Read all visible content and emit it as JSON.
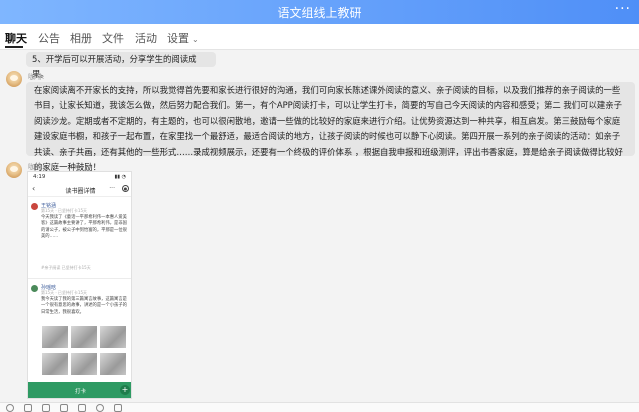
{
  "window": {
    "title": "语文组线上教研",
    "more_label": "···"
  },
  "tabs": [
    {
      "label": "聊天"
    },
    {
      "label": "公告"
    },
    {
      "label": "相册"
    },
    {
      "label": "文件"
    },
    {
      "label": "活动"
    },
    {
      "label": "设置"
    }
  ],
  "messages": [
    {
      "text": "5、开学后可以开展活动，分享学生的阅读成果。"
    },
    {
      "sender": "咖啡.",
      "text": "在家阅读离不开家长的支持，所以我觉得首先要和家长进行很好的沟通，我们可向家长陈述课外阅读的意义、亲子阅读的目标，以及我们推荐的亲子阅读的一些书目，让家长知道，我该怎么做，然后努力配合我们。第一，有个APP阅读打卡，可以让学生打卡，简要的写自己今天阅读的内容和感受；第二 我们可以建亲子阅读沙龙。定期或者不定期的，有主题的，也可以很闲散地，邀请一些做的比较好的家庭来进行介绍。让优势资源达到一种共享，相互启发。第三鼓励每个家庭建设家庭书橱，和孩子一起布置，在家里找一个最舒适，最适合阅读的地方，让孩子阅读的时候也可以静下心阅读。第四开展一系列的亲子阅读的活动：如亲子共读、亲子共画，还有其他的一些形式……录成视频展示，还要有一个终极的评价体系 ，根据自我申报和班级测评，评出书香家庭，算是给亲子阅读做得比较好的家庭一种鼓励！"
    },
    {
      "sender": "咖啡."
    }
  ],
  "screenshot": {
    "time": "4:19",
    "status_icons": "▮▮ ◔",
    "header_title": "读书圈详情",
    "back_icon": "‹",
    "menu_icon": "···",
    "posts": [
      {
        "name": "王铭涵",
        "meta": "第15天 · 已坚持打卡15天",
        "text": "今天我读了《童话—平那希利伟一本惠人爱美客》这篇故事主要讲了，平那希利伟，是非国的请公子，被公子中到怡富的，平那是一位很美的……",
        "footer": "#亲子阅读 已坚持打卡15天"
      },
      {
        "name": "孙瑶晗",
        "meta": "第15天 · 已坚持打卡15天",
        "text": "我今天读了我的第三篇寓言故事，这篇寓言是一个很有意思的故事，讲述的是一个小孩子的日常生活，我很喜欢。"
      }
    ],
    "clock_label": "打卡",
    "plus_label": "+"
  },
  "colors": {
    "accent": "#4f8ff7",
    "bubble": "#e5e5e5",
    "clock_green": "#2e9a63"
  }
}
